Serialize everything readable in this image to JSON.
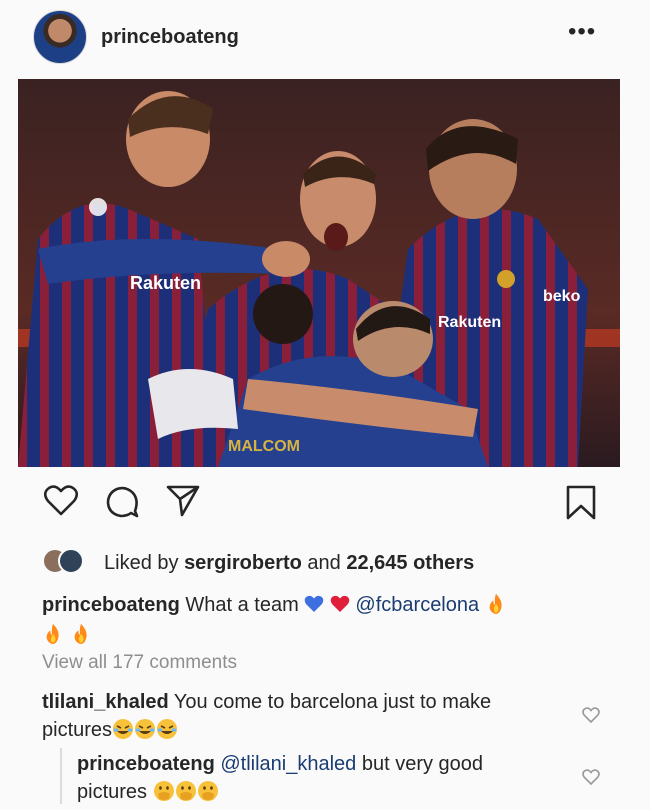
{
  "post": {
    "username": "princeboateng",
    "more_label": "•••",
    "photo_alt": "",
    "shirt_texts": [
      "Rakuten",
      "beko",
      "Rakuten",
      "MALCOM"
    ]
  },
  "likes": {
    "prefix": "Liked by ",
    "user": "sergiroberto",
    "middle": " and ",
    "count": "22,645 others"
  },
  "caption": {
    "username": "princeboateng",
    "text": " What a team ",
    "mention": "@fcbarcelona",
    "emoji_colors": {
      "blue_heart": "#3d6fe0",
      "red_heart": "#e0203a",
      "fire": "#ff8a1a"
    }
  },
  "comments": {
    "view_all": "View all 177 comments",
    "items": [
      {
        "username": "tlilani_khaled",
        "text": " You come to barcelona just to make pictures"
      },
      {
        "username": "princeboateng",
        "mention": " @tlilani_khaled",
        "text": " but very good pictures"
      }
    ]
  },
  "icons": [
    "heart-icon",
    "comment-icon",
    "share-icon",
    "bookmark-icon",
    "small-heart-icon"
  ]
}
